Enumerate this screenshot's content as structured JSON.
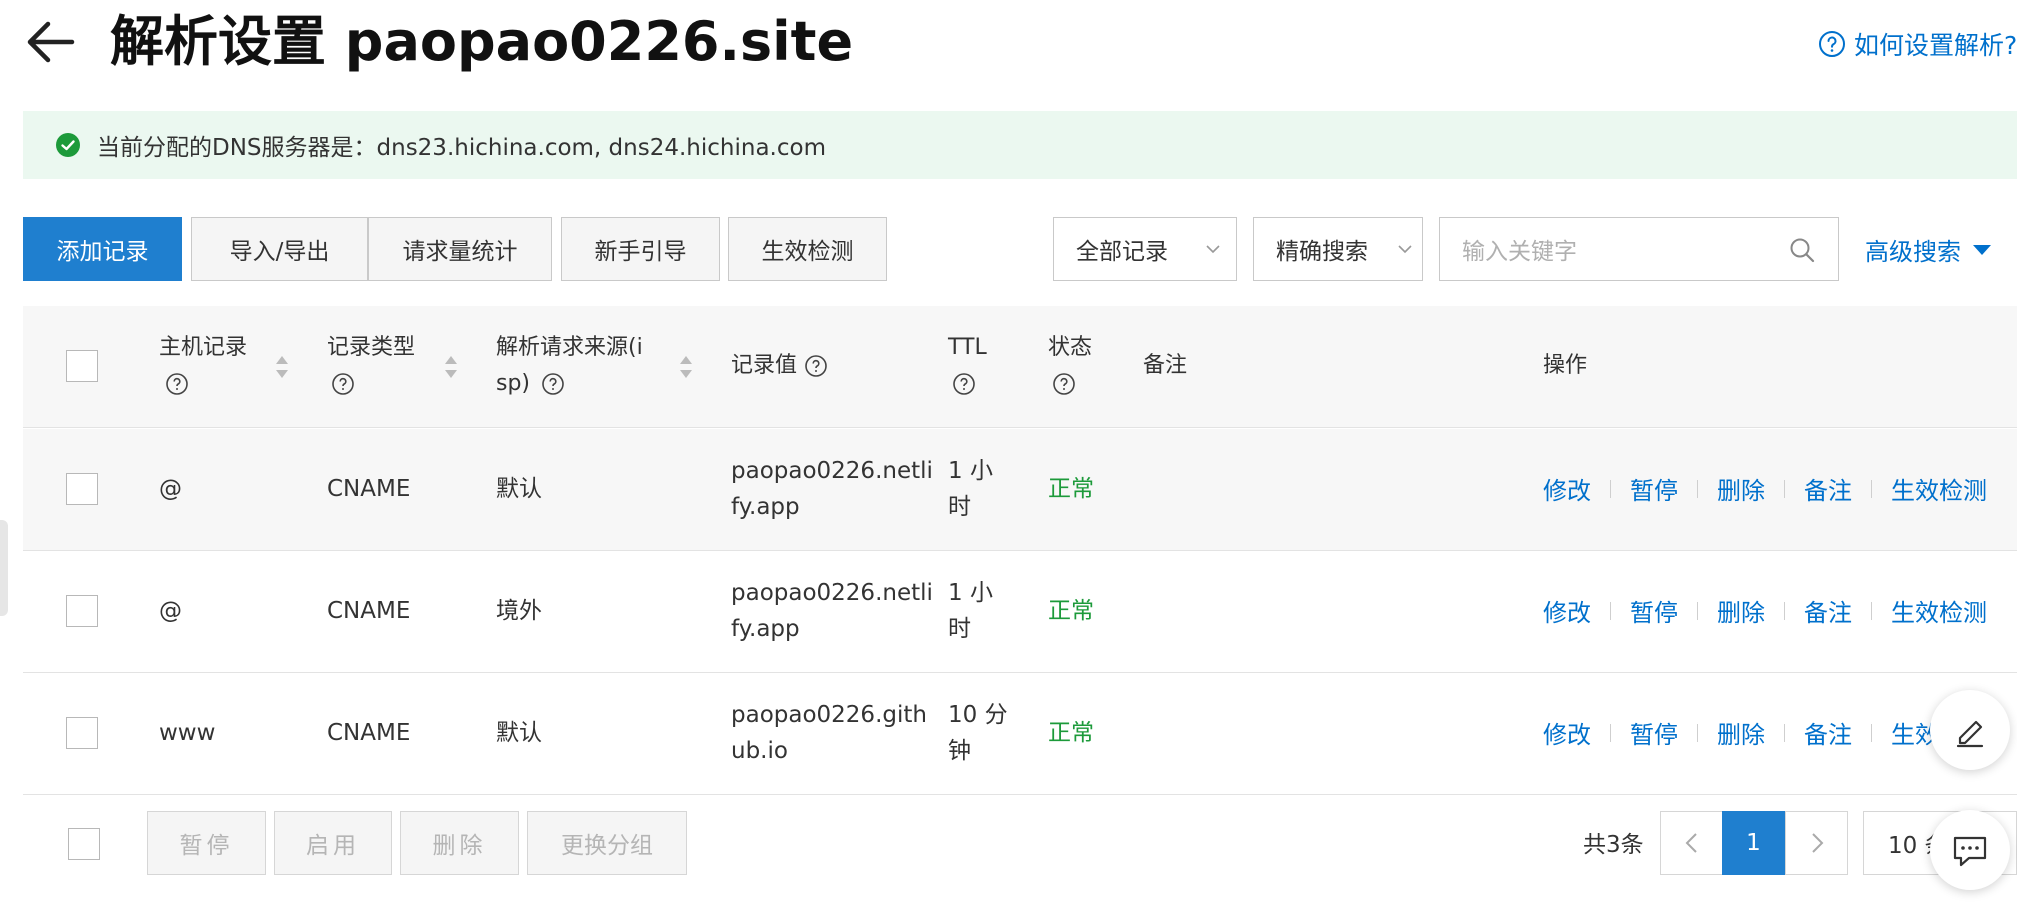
{
  "header": {
    "title": "解析设置 paopao0226.site",
    "help_link": "如何设置解析?"
  },
  "banner": {
    "text": "当前分配的DNS服务器是：dns23.hichina.com, dns24.hichina.com"
  },
  "toolbar": {
    "add_record": "添加记录",
    "import_export": "导入/导出",
    "request_stats": "请求量统计",
    "guide": "新手引导",
    "effect_check": "生效检测",
    "record_filter": "全部记录",
    "search_mode": "精确搜索",
    "search_placeholder": "输入关键字",
    "advanced_search": "高级搜索"
  },
  "table": {
    "columns": {
      "host": "主机记录",
      "type": "记录类型",
      "isp_line1": "解析请求来源(i",
      "isp_line2": "sp)",
      "value": "记录值",
      "ttl": "TTL",
      "status": "状态",
      "remark": "备注",
      "ops": "操作"
    },
    "actions": [
      "修改",
      "暂停",
      "删除",
      "备注",
      "生效检测"
    ],
    "rows": [
      {
        "host": "@",
        "type": "CNAME",
        "isp": "默认",
        "value_l1": "paopao0226.netli",
        "value_l2": "fy.app",
        "ttl_l1": "1 小",
        "ttl_l2": "时",
        "status": "正常"
      },
      {
        "host": "@",
        "type": "CNAME",
        "isp": "境外",
        "value_l1": "paopao0226.netli",
        "value_l2": "fy.app",
        "ttl_l1": "1 小",
        "ttl_l2": "时",
        "status": "正常"
      },
      {
        "host": "www",
        "type": "CNAME",
        "isp": "默认",
        "value_l1": "paopao0226.gith",
        "value_l2": "ub.io",
        "ttl_l1": "10 分",
        "ttl_l2": "钟",
        "status": "正常"
      }
    ]
  },
  "footer": {
    "pause": "暂停",
    "enable": "启用",
    "delete": "删除",
    "change_group": "更换分组",
    "total": "共3条",
    "current_page": "1",
    "page_size": "10 条/页"
  },
  "colors": {
    "primary": "#1f7fcf",
    "link": "#0070cc",
    "status_ok": "#1c9a3a",
    "banner_bg": "#ebf8f0"
  },
  "icons": [
    "back-arrow-icon",
    "help-icon",
    "check-circle-icon",
    "chevron-down-icon",
    "search-icon",
    "caret-down-icon",
    "question-icon",
    "sort-icon",
    "chevron-left-icon",
    "chevron-right-icon",
    "edit-icon",
    "chat-icon"
  ]
}
